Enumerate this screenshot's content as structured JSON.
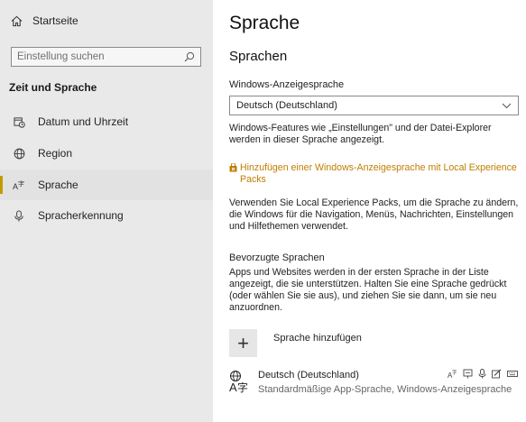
{
  "sidebar": {
    "home_label": "Startseite",
    "search_placeholder": "Einstellung suchen",
    "section_title": "Zeit und Sprache",
    "items": [
      {
        "label": "Datum und Uhrzeit",
        "icon": "calendar-clock-icon"
      },
      {
        "label": "Region",
        "icon": "globe-icon"
      },
      {
        "label": "Sprache",
        "icon": "language-icon",
        "active": true
      },
      {
        "label": "Spracherkennung",
        "icon": "microphone-icon"
      }
    ],
    "accent_color": "#c19c00"
  },
  "main": {
    "title": "Sprache",
    "section_title": "Sprachen",
    "display_lang_label": "Windows-Anzeigesprache",
    "display_lang_value": "Deutsch (Deutschland)",
    "display_lang_note": "Windows-Features wie „Einstellungen\" und der Datei-Explorer werden in dieser Sprache angezeigt.",
    "lxp_link": "Hinzufügen einer Windows-Anzeigesprache mit Local Experience Packs",
    "lxp_link_color": "#c17d00",
    "lxp_note": "Verwenden Sie Local Experience Packs, um die Sprache zu ändern, die Windows für die Navigation, Menüs, Nachrichten, Einstellungen und Hilfethemen verwendet.",
    "preferred_label": "Bevorzugte Sprachen",
    "preferred_note": "Apps und Websites werden in der ersten Sprache in der Liste angezeigt, die sie unterstützen. Halten Sie eine Sprache gedrückt (oder wählen Sie sie aus), und ziehen Sie sie dann, um sie neu anzuordnen.",
    "add_label": "Sprache hinzufügen",
    "languages": [
      {
        "name": "Deutsch (Deutschland)",
        "subtitle": "Standardmäßige App-Sprache, Windows-Anzeigesprache"
      }
    ]
  }
}
